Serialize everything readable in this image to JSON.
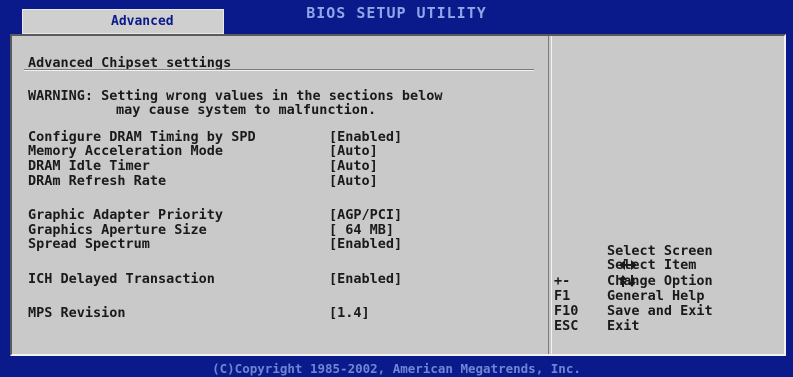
{
  "header": {
    "title": "BIOS SETUP UTILITY",
    "active_tab": "Advanced"
  },
  "main": {
    "section_title": "Advanced Chipset settings",
    "warning_line1": "WARNING: Setting wrong values in the sections below",
    "warning_line2": "may cause system to malfunction.",
    "settings": [
      {
        "label": "Configure DRAM Timing by SPD",
        "value": "[Enabled]"
      },
      {
        "label": "Memory Acceleration Mode",
        "value": "[Auto]"
      },
      {
        "label": "DRAM Idle Timer",
        "value": "[Auto]"
      },
      {
        "label": "DRAm Refresh Rate",
        "value": "[Auto]"
      },
      {
        "label": "Graphic Adapter Priority",
        "value": "[AGP/PCI]"
      },
      {
        "label": "Graphics Aperture Size",
        "value": "[ 64 MB]"
      },
      {
        "label": "Spread Spectrum",
        "value": "[Enabled]"
      },
      {
        "label": "ICH Delayed Transaction",
        "value": "[Enabled]"
      },
      {
        "label": "MPS Revision",
        "value": "[1.4]"
      }
    ]
  },
  "help": {
    "items": [
      {
        "key": "",
        "key_icon": "left-right-arrows-icon",
        "desc": "Select Screen"
      },
      {
        "key": "",
        "key_icon": "up-down-arrows-icon",
        "desc": "Select Item"
      },
      {
        "key": "+-",
        "desc": "Change Option"
      },
      {
        "key": "F1",
        "desc": "General Help"
      },
      {
        "key": "F10",
        "desc": "Save and Exit"
      },
      {
        "key": "ESC",
        "desc": "Exit"
      }
    ]
  },
  "footer": {
    "copyright": "(C)Copyright 1985-2002, American Megatrends, Inc."
  },
  "colors": {
    "background": "#0b1a8a",
    "panel": "#c9c9c9",
    "text": "#1a1a1a",
    "title": "#8fa6e8"
  }
}
